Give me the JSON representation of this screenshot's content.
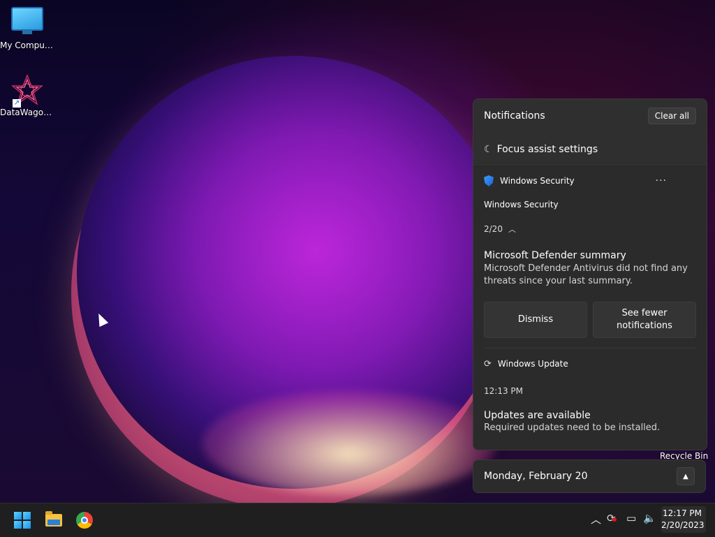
{
  "desktop": {
    "icons": [
      {
        "label": "My Computer"
      },
      {
        "label": "DataWagon..."
      }
    ],
    "recycle_bin": "Recycle Bin"
  },
  "notifications": {
    "title": "Notifications",
    "clear_all": "Clear all",
    "focus_assist": "Focus assist settings",
    "items": [
      {
        "app": "Windows Security",
        "more": "···",
        "source": "Windows Security",
        "count": "2/20",
        "title": "Microsoft Defender summary",
        "body_line1": "Microsoft Defender Antivirus did not find any",
        "body_line2": "threats since your last summary.",
        "actions": [
          {
            "label": "Dismiss"
          },
          {
            "label_line1": "See fewer",
            "label_line2": "notifications"
          }
        ]
      },
      {
        "app": "Windows Update",
        "time": "12:13 PM",
        "title": "Updates are available",
        "body": "Required updates need to be installed."
      }
    ]
  },
  "calendar": {
    "date": "Monday, February 20"
  },
  "taskbar": {
    "clock_time": "12:17 PM",
    "clock_date": "2/20/2023"
  },
  "icons": {
    "focus_assist": "moon-icon",
    "security": "shield-icon",
    "update": "sync-icon",
    "calendar_toggle": "chevron-up-icon"
  },
  "colors": {
    "panel_bg": "#2b2b2b",
    "taskbar_bg": "#1f1f1f",
    "accent_blue": "#1b8fe8"
  }
}
